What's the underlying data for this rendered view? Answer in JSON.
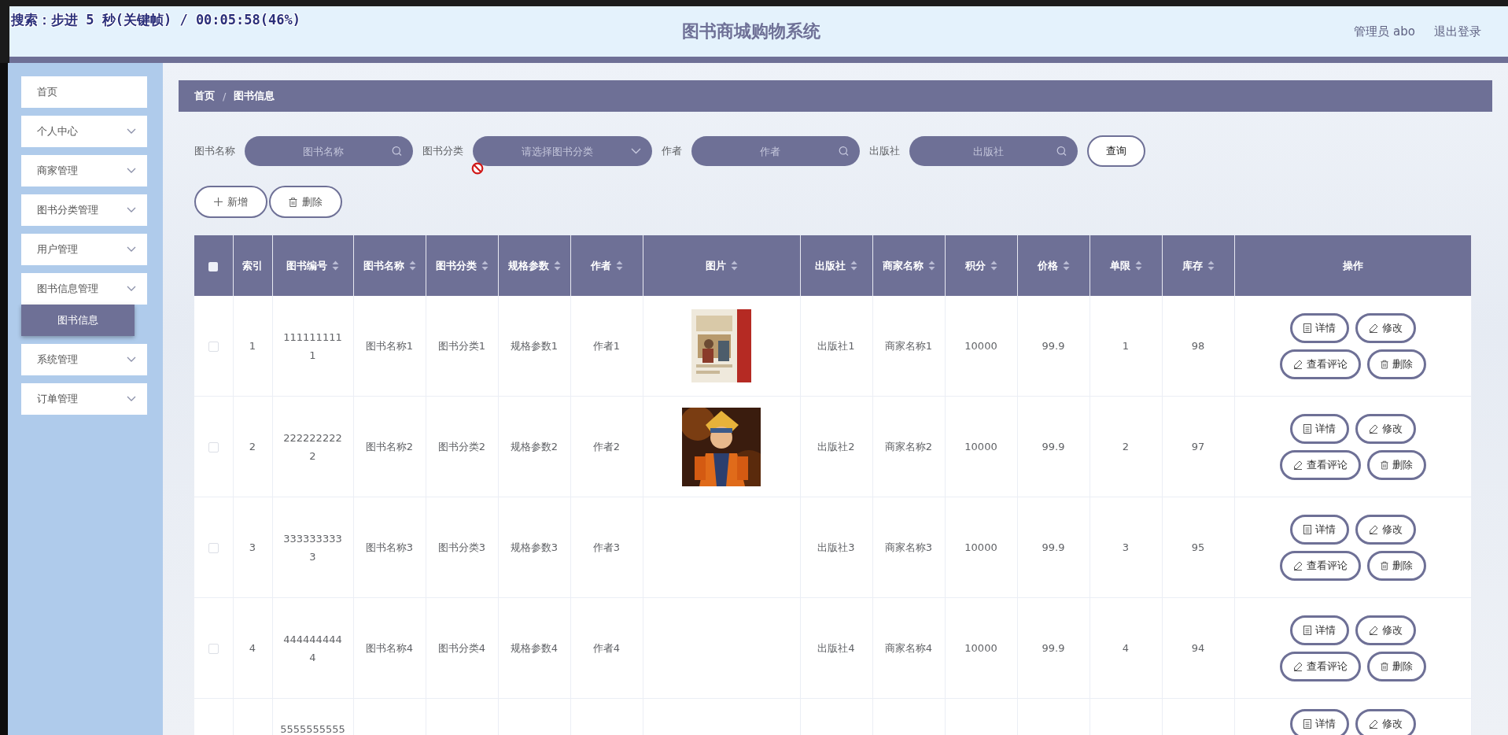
{
  "overlay_text": "搜索：步进 5 秒(关键帧) / 00:05:58(46%)",
  "header": {
    "title": "图书商城购物系统",
    "user": "管理员 abo",
    "logout": "退出登录"
  },
  "sidebar": {
    "items": [
      {
        "label": "首页",
        "submenu": false
      },
      {
        "label": "个人中心",
        "submenu": true
      },
      {
        "label": "商家管理",
        "submenu": true
      },
      {
        "label": "图书分类管理",
        "submenu": true
      },
      {
        "label": "用户管理",
        "submenu": true
      },
      {
        "label": "图书信息管理",
        "submenu": true,
        "children": [
          {
            "label": "图书信息",
            "selected": true
          }
        ]
      },
      {
        "label": "系统管理",
        "submenu": true
      },
      {
        "label": "订单管理",
        "submenu": true
      }
    ]
  },
  "breadcrumb": {
    "separator": "/",
    "items": [
      "首页",
      "图书信息"
    ]
  },
  "filters": [
    {
      "label": "图书名称",
      "kind": "search",
      "placeholder": "图书名称"
    },
    {
      "label": "图书分类",
      "kind": "select",
      "placeholder": "请选择图书分类"
    },
    {
      "label": "作者",
      "kind": "search",
      "placeholder": "作者"
    },
    {
      "label": "出版社",
      "kind": "search",
      "placeholder": "出版社"
    }
  ],
  "query_button": "查询",
  "toolbar": [
    {
      "label": "新增",
      "kind": "add"
    },
    {
      "label": "删除",
      "kind": "delete"
    }
  ],
  "table": {
    "select_all_checked": false,
    "columns": [
      {
        "label": "索引",
        "sortable": false
      },
      {
        "label": "图书编号",
        "sortable": true
      },
      {
        "label": "图书名称",
        "sortable": true
      },
      {
        "label": "图书分类",
        "sortable": true
      },
      {
        "label": "规格参数",
        "sortable": true
      },
      {
        "label": "作者",
        "sortable": true
      },
      {
        "label": "图片",
        "sortable": true
      },
      {
        "label": "出版社",
        "sortable": true
      },
      {
        "label": "商家名称",
        "sortable": true
      },
      {
        "label": "积分",
        "sortable": true
      },
      {
        "label": "价格",
        "sortable": true
      },
      {
        "label": "单限",
        "sortable": true
      },
      {
        "label": "库存",
        "sortable": true
      },
      {
        "label": "操作",
        "sortable": false
      }
    ],
    "rows": [
      {
        "checked": false,
        "cells": [
          "1",
          "111111111\n1",
          "图书名称1",
          "图书分类1",
          "规格参数1",
          "作者1",
          null,
          "出版社1",
          "商家名称1",
          "10000",
          "99.9",
          "1",
          "98"
        ],
        "image": {
          "kind": "picture"
        },
        "actions": [
          {
            "label": "详情",
            "kind": "details"
          },
          {
            "label": "修改",
            "kind": "edit"
          },
          {
            "label": "查看评论",
            "kind": "comments"
          },
          {
            "label": "删除",
            "kind": "delete"
          }
        ]
      },
      {
        "checked": false,
        "cells": [
          "2",
          "222222222\n2",
          "图书名称2",
          "图书分类2",
          "规格参数2",
          "作者2",
          null,
          "出版社2",
          "商家名称2",
          "10000",
          "99.9",
          "2",
          "97"
        ],
        "image": {
          "kind": "picture"
        },
        "actions": [
          {
            "label": "详情",
            "kind": "details"
          },
          {
            "label": "修改",
            "kind": "edit"
          },
          {
            "label": "查看评论",
            "kind": "comments"
          },
          {
            "label": "删除",
            "kind": "delete"
          }
        ]
      },
      {
        "checked": false,
        "cells": [
          "3",
          "333333333\n3",
          "图书名称3",
          "图书分类3",
          "规格参数3",
          "作者3",
          null,
          "出版社3",
          "商家名称3",
          "10000",
          "99.9",
          "3",
          "95"
        ],
        "actions": [
          {
            "label": "详情",
            "kind": "details"
          },
          {
            "label": "修改",
            "kind": "edit"
          },
          {
            "label": "查看评论",
            "kind": "comments"
          },
          {
            "label": "删除",
            "kind": "delete"
          }
        ]
      },
      {
        "checked": false,
        "cells": [
          "4",
          "444444444\n4",
          "图书名称4",
          "图书分类4",
          "规格参数4",
          "作者4",
          null,
          "出版社4",
          "商家名称4",
          "10000",
          "99.9",
          "4",
          "94"
        ],
        "actions": [
          {
            "label": "详情",
            "kind": "details"
          },
          {
            "label": "修改",
            "kind": "edit"
          },
          {
            "label": "查看评论",
            "kind": "comments"
          },
          {
            "label": "删除",
            "kind": "delete"
          }
        ]
      },
      {
        "cut_off": true,
        "cells": [
          null,
          "5555555555",
          null,
          null,
          null,
          null,
          null,
          null,
          null,
          null,
          null,
          null,
          null
        ],
        "actions": [
          {
            "label": "详情",
            "kind": "details"
          },
          {
            "label": "修改",
            "kind": "edit"
          }
        ]
      }
    ]
  }
}
